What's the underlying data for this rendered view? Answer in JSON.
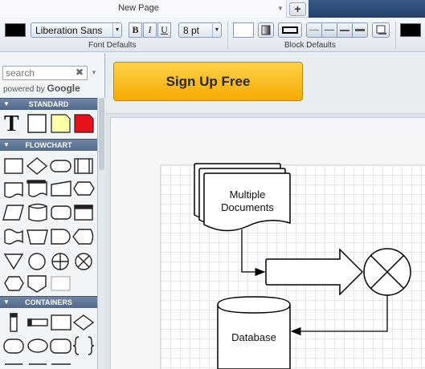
{
  "tab": {
    "title": "New Page",
    "add_label": "+"
  },
  "toolbar": {
    "font_color": "#000000",
    "font_family": "Liberation Sans",
    "bold_label": "B",
    "italic_label": "I",
    "underline_label": "U",
    "font_size": "8 pt",
    "font_defaults_label": "Font Defaults",
    "fill_color": "#ffffff",
    "line_color": "#000000",
    "block_defaults_label": "Block Defaults"
  },
  "sidebar": {
    "search_placeholder": "search",
    "powered_by": "powered by",
    "google": "Google",
    "categories": [
      "STANDARD",
      "FLOWCHART",
      "CONTAINERS"
    ]
  },
  "ad": {
    "signup_label": "Sign Up Free"
  },
  "diagram": {
    "multiple_documents_line1": "Multiple",
    "multiple_documents_line2": "Documents",
    "database_label": "Database"
  },
  "colors": {
    "signup_top": "#ffd24a",
    "signup_bottom": "#f4a900",
    "note_yellow": "#ffffa8",
    "note_red": "#e8101a",
    "tab_strip": "#24406a"
  }
}
